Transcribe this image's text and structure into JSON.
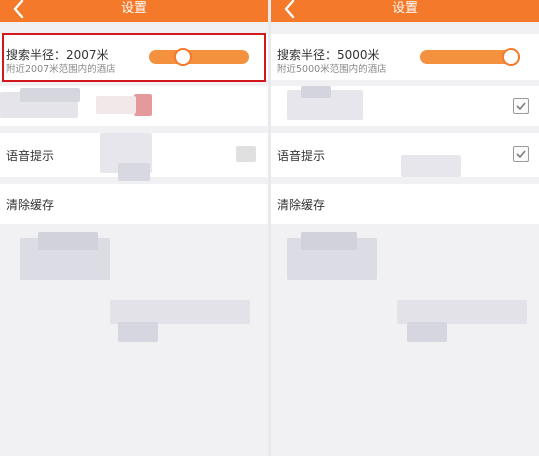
{
  "screens": [
    {
      "header": {
        "title": "设置"
      },
      "search_radius": {
        "label": "搜索半径：2007米",
        "hint": "附近2007米范围内的酒店",
        "slider_value_fraction": 0.3
      },
      "voice_prompt": {
        "label": "语音提示"
      },
      "clear_cache": {
        "label": "清除缓存"
      }
    },
    {
      "header": {
        "title": "设置"
      },
      "search_radius": {
        "label": "搜索半径：5000米",
        "hint": "附近5000米范围内的酒店",
        "slider_value_fraction": 1.0
      },
      "voice_prompt": {
        "label": "语音提示",
        "checked": true
      },
      "clear_cache": {
        "label": "清除缓存"
      }
    }
  ],
  "colors": {
    "accent": "#f4792a",
    "slider_track": "#f4913f",
    "highlight_border": "#d3181d"
  },
  "icons": [
    "back-icon",
    "checkmark-icon"
  ]
}
